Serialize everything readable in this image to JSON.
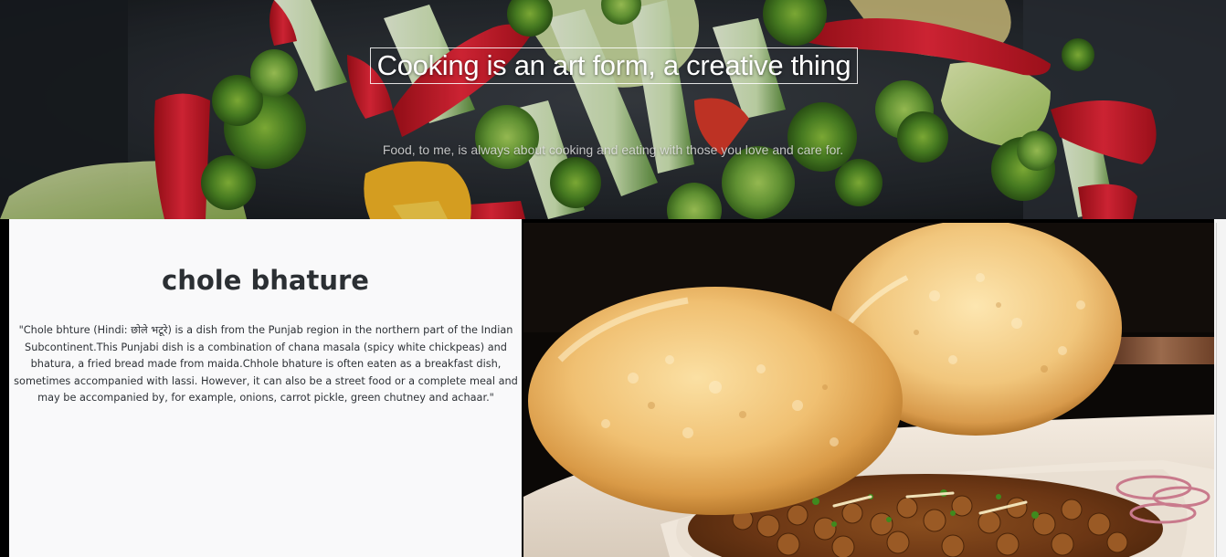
{
  "hero": {
    "title": "Cooking is an art form, a creative thing",
    "subtitle": "Food, to me, is always about cooking and eating with those you love and care for.",
    "background_image": "stir-fried vegetables"
  },
  "dish": {
    "title": "chole bhature",
    "description": "\"Chole bhture (Hindi: छोले भटूरे) is a dish from the Punjab region in the northern part of the Indian Subcontinent.This Punjabi dish is a combination of chana masala (spicy white chickpeas) and bhatura, a fried bread made from maida.Chhole bhature is often eaten as a breakfast dish, sometimes accompanied with lassi. However, it can also be a street food or a complete meal and may be accompanied by, for example, onions, carrot pickle, green chutney and achaar.\"",
    "image": "chole bhature photo"
  },
  "colors": {
    "text_panel_bg": "#f9f9fa",
    "heading": "#2b2f33",
    "body_text": "#2d3136",
    "hero_title": "#ffffff"
  }
}
